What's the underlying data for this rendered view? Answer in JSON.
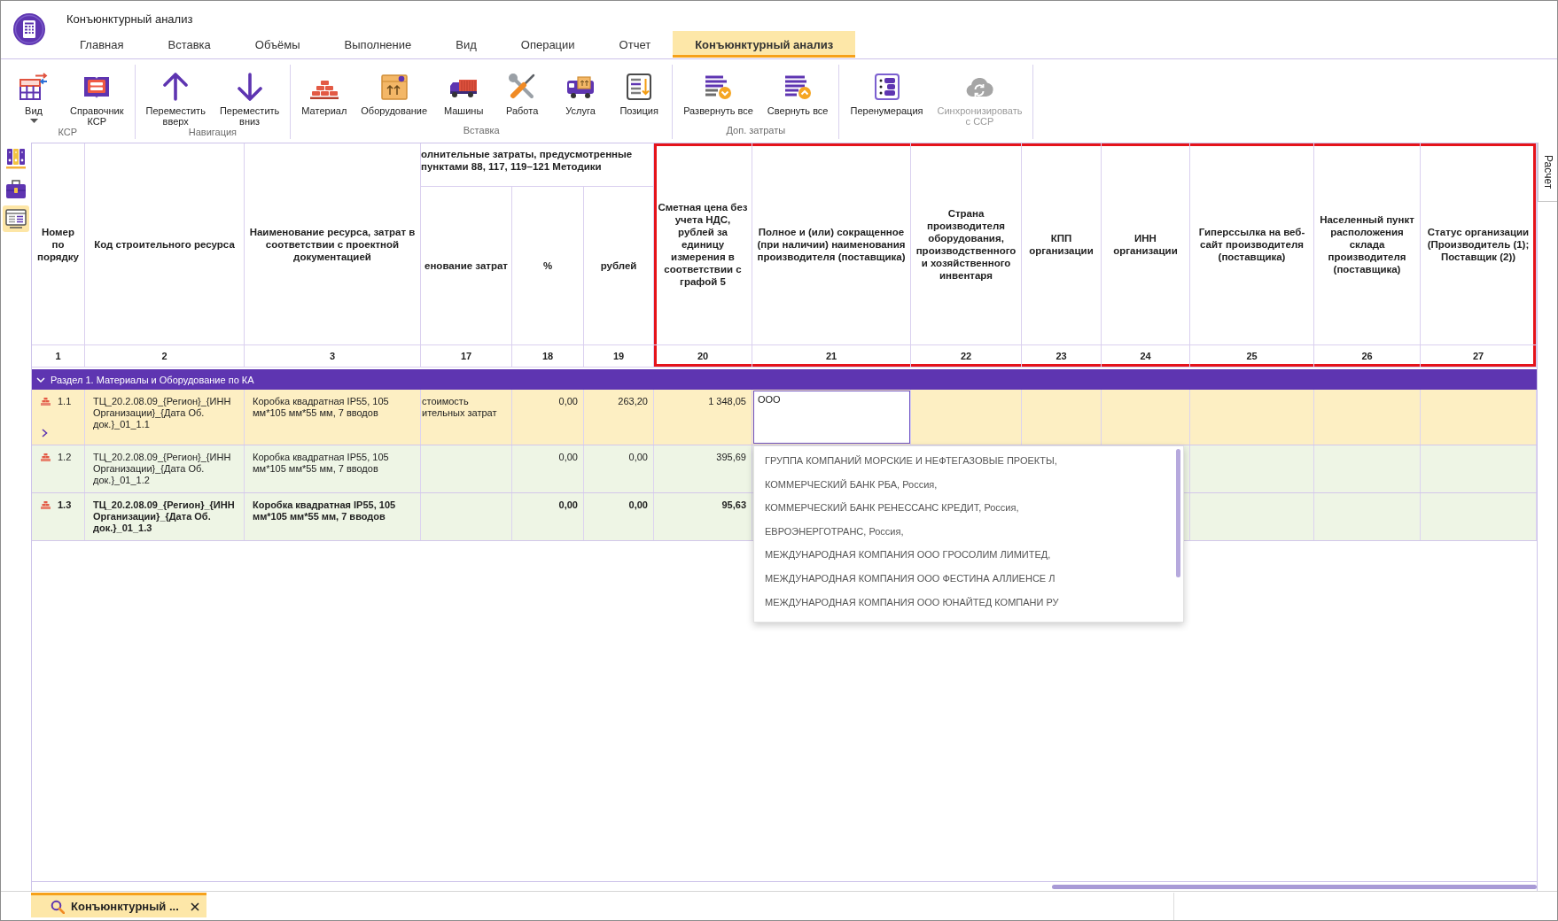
{
  "window": {
    "title": "Конъюнктурный анализ"
  },
  "menu_tabs": [
    {
      "label": "Главная",
      "selected": false
    },
    {
      "label": "Вставка",
      "selected": false
    },
    {
      "label": "Объёмы",
      "selected": false
    },
    {
      "label": "Выполнение",
      "selected": false
    },
    {
      "label": "Вид",
      "selected": false
    },
    {
      "label": "Операции",
      "selected": false
    },
    {
      "label": "Отчет",
      "selected": false
    },
    {
      "label": "Конъюнктурный анализ",
      "selected": true
    }
  ],
  "ribbon": {
    "groups": [
      {
        "label": "КСР",
        "buttons": [
          {
            "label": "Вид",
            "dropdown": true,
            "disabled": false
          },
          {
            "label": "Справочник\nКСР",
            "dropdown": false,
            "disabled": false
          }
        ]
      },
      {
        "label": "Навигация",
        "buttons": [
          {
            "label": "Переместить\nвверх",
            "dropdown": false,
            "disabled": false
          },
          {
            "label": "Переместить\nвниз",
            "dropdown": false,
            "disabled": false
          }
        ]
      },
      {
        "label": "Вставка",
        "buttons": [
          {
            "label": "Материал",
            "dropdown": false,
            "disabled": false
          },
          {
            "label": "Оборудование",
            "dropdown": false,
            "disabled": false
          },
          {
            "label": "Машины",
            "dropdown": false,
            "disabled": false
          },
          {
            "label": "Работа",
            "dropdown": false,
            "disabled": false
          },
          {
            "label": "Услуга",
            "dropdown": false,
            "disabled": false
          },
          {
            "label": "Позиция",
            "dropdown": false,
            "disabled": false
          }
        ]
      },
      {
        "label": "Доп. затраты",
        "buttons": [
          {
            "label": "Развернуть все",
            "dropdown": false,
            "disabled": false
          },
          {
            "label": "Свернуть все",
            "dropdown": false,
            "disabled": false
          }
        ]
      },
      {
        "buttons": [
          {
            "label": "Перенумерация",
            "dropdown": false,
            "disabled": false
          },
          {
            "label": "Синхронизировать\nс ССР",
            "dropdown": false,
            "disabled": true
          }
        ]
      }
    ]
  },
  "side_panel": [
    {
      "selected": false
    },
    {
      "selected": false
    },
    {
      "selected": true
    }
  ],
  "table": {
    "columns": [
      {
        "title": "Номер по порядку",
        "number": "1",
        "highlighted": false
      },
      {
        "title": "Код строительного ресурса",
        "number": "2",
        "highlighted": false
      },
      {
        "title": "Наименование ресурса, затрат в соответствии с проектной документацией",
        "number": "3",
        "highlighted": false
      },
      {
        "title": "олнительные затраты, предусмотренные пунктами 88, 117, 119–121 Методики",
        "children": [
          {
            "title": "енование затрат",
            "number": "17",
            "highlighted": false
          },
          {
            "title": "%",
            "number": "18",
            "highlighted": false
          },
          {
            "title": "рублей",
            "number": "19",
            "highlighted": false
          }
        ]
      },
      {
        "title": "Сметная цена без учета НДС, рублей за единицу измерения в соответствии с графой 5",
        "number": "20",
        "highlighted": true
      },
      {
        "title": "Полное и (или) сокращенное (при наличии) наименования производителя (поставщика)",
        "number": "21",
        "highlighted": true
      },
      {
        "title": "Страна производителя оборудования, производственного и хозяйственного инвентаря",
        "number": "22",
        "highlighted": true
      },
      {
        "title": "КПП организации",
        "number": "23",
        "highlighted": true
      },
      {
        "title": "ИНН организации",
        "number": "24",
        "highlighted": true
      },
      {
        "title": "Гиперссылка на веб-сайт производителя (поставщика)",
        "number": "25",
        "highlighted": true
      },
      {
        "title": "Населенный пункт расположения склада производителя (поставщика)",
        "number": "26",
        "highlighted": true
      },
      {
        "title": "Статус организации (Производитель (1); Поставщик (2))",
        "number": "27",
        "highlighted": true
      }
    ],
    "sections": [
      {
        "title": "Раздел 1. Материалы и Оборудование по КА",
        "expanded": true,
        "rows": [
          {
            "number": "1.1",
            "selected": true,
            "bold": false,
            "expandable": true,
            "code": "ТЦ_20.2.08.09_{Регион}_{ИНН Организации}_{Дата Об. док.}_01_1.1",
            "name": "Коробка квадратная IP55, 105 мм*105 мм*55 мм, 7 вводов",
            "column_17": "стоимость ительных затрат",
            "percent": "0,00",
            "rubles": "263,20",
            "price": "1 348,05",
            "supplier": {
              "value": "ООО",
              "editing": true,
              "suggestions": [
                "ГРУППА КОМПАНИЙ МОРСКИЕ И НЕФТЕГАЗОВЫЕ ПРОЕКТЫ,",
                "КОММЕРЧЕСКИЙ БАНК РБА, Россия,",
                "КОММЕРЧЕСКИЙ БАНК РЕНЕССАНС КРЕДИТ, Россия,",
                "ЕВРОЭНЕРГОТРАНС, Россия,",
                "МЕЖДУНАРОДНАЯ КОМПАНИЯ ООО ГРОСОЛИМ ЛИМИТЕД,",
                "МЕЖДУНАРОДНАЯ КОМПАНИЯ ООО ФЕСТИНА АЛЛИЕНСЕ Л",
                "МЕЖДУНАРОДНАЯ КОМПАНИЯ ООО ЮНАЙТЕД КОМПАНИ РУ"
              ]
            }
          },
          {
            "number": "1.2",
            "selected": false,
            "bold": false,
            "expandable": false,
            "code": "ТЦ_20.2.08.09_{Регион}_{ИНН Организации}_{Дата Об. док.}_01_1.2",
            "name": "Коробка квадратная IP55, 105 мм*105 мм*55 мм, 7 вводов",
            "percent": "0,00",
            "rubles": "0,00",
            "price": "395,69"
          },
          {
            "number": "1.3",
            "selected": false,
            "bold": true,
            "expandable": false,
            "code": "ТЦ_20.2.08.09_{Регион}_{ИНН Организации}_{Дата Об. док.}_01_1.3",
            "name": "Коробка квадратная IP55, 105 мм*105 мм*55 мм, 7 вводов",
            "percent": "0,00",
            "rubles": "0,00",
            "price": "95,63"
          }
        ]
      }
    ]
  },
  "right_panel_tabs": [
    {
      "label": "Расчет",
      "selected": false
    }
  ],
  "document_tabs": [
    {
      "label": "Конъюнктурный ...",
      "selected": true
    }
  ]
}
